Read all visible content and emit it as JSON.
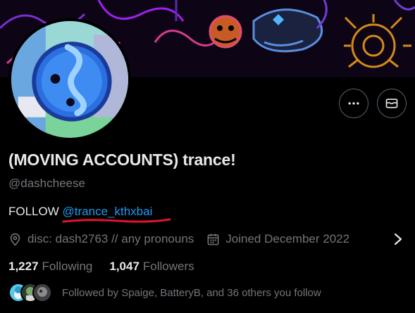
{
  "profile": {
    "display_name": "(MOVING ACCOUNTS) trance!",
    "handle": "@dashcheese",
    "bio_prefix": "FOLLOW ",
    "bio_mention": "@trance_kthxbai",
    "location": "disc: dash2763 // any pronouns",
    "joined": "Joined December 2022"
  },
  "stats": {
    "following_count": "1,227",
    "following_label": "Following",
    "followers_count": "1,047",
    "followers_label": "Followers"
  },
  "followed_by": "Followed by Spaige, BatteryB, and 36 others you follow",
  "icons": {
    "more": "more-horizontal-icon",
    "message": "envelope-icon",
    "location": "location-pin-icon",
    "calendar": "calendar-icon",
    "chevron": "chevron-right-icon"
  },
  "colors": {
    "background": "#000000",
    "text_primary": "#e7e9ea",
    "text_secondary": "#71767b",
    "link": "#1d9bf0",
    "annotation_underline": "#e0142b"
  }
}
